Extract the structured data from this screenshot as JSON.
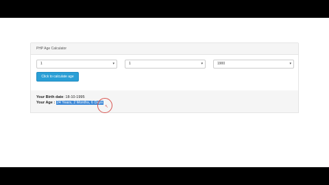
{
  "calculator": {
    "title": "PHP Age Calculator",
    "day": "1",
    "month": "1",
    "year": "1900",
    "button": "Click to calculate age"
  },
  "result": {
    "birth_label": "Your Birth date",
    "birth_value": "18-10-1995",
    "age_label": "Your Age :",
    "age_value": "24 Years, 2 Months, 6 Days"
  },
  "toolbar": {
    "pause_icon": "pause-icon",
    "pointer_icon": "pointer-icon",
    "pen_icon": "pen-icon",
    "highlighter_icon": "highlighter-icon",
    "close_icon": "close-icon"
  }
}
